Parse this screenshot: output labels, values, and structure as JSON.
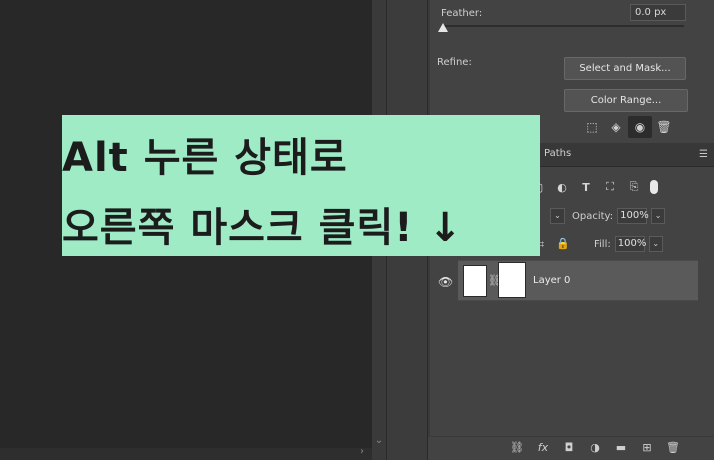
{
  "properties": {
    "feather_label": "Feather:",
    "feather_value": "0.0 px",
    "refine_label": "Refine:",
    "select_and_mask_label": "Select and Mask...",
    "color_range_label": "Color Range..."
  },
  "mask_toolbar": {
    "icons": [
      "selection-icon",
      "apply-mask-icon",
      "visibility-icon",
      "delete-icon"
    ]
  },
  "layers_panel": {
    "tab_paths": "Paths",
    "opacity_label": "Opacity:",
    "opacity_value": "100%",
    "fill_label": "Fill:",
    "fill_value": "100%",
    "layers": [
      {
        "name": "Layer 0",
        "visible": true
      }
    ]
  },
  "overlay": {
    "line1": "Alt 누른 상태로",
    "line2": "오른쪽 마스크 클릭! ↓",
    "background": "#9eebc6"
  },
  "colors": {
    "panel": "#434343",
    "canvas": "#282828",
    "selected_layer": "#5a5a5a"
  }
}
